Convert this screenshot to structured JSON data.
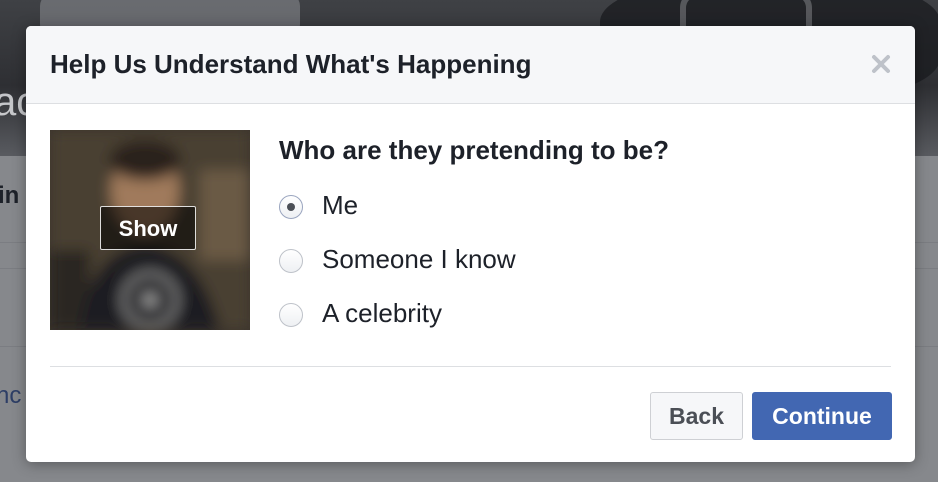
{
  "background": {
    "cover_text": "ac",
    "partial_text_1": "in",
    "partial_text_2": "nc"
  },
  "dialog": {
    "title": "Help Us Understand What's Happening",
    "close_icon": "close-icon",
    "photo": {
      "show_label": "Show",
      "state": "blurred"
    },
    "question": "Who are they pretending to be?",
    "options": [
      {
        "label": "Me",
        "checked": true
      },
      {
        "label": "Someone I know",
        "checked": false
      },
      {
        "label": "A celebrity",
        "checked": false
      }
    ],
    "buttons": {
      "back_label": "Back",
      "continue_label": "Continue"
    }
  },
  "colors": {
    "primary_button": "#4267b2",
    "header_bg": "#f6f7f9",
    "text": "#1d2129"
  }
}
